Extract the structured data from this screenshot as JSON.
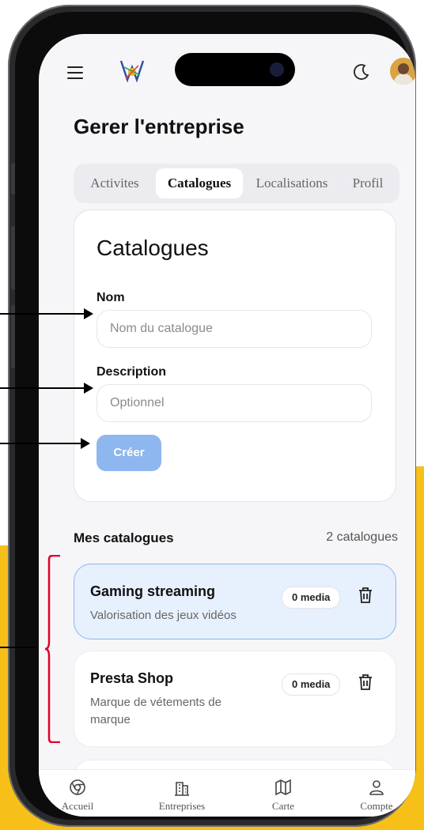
{
  "header": {
    "title": "Gerer l'entreprise"
  },
  "tabs": [
    {
      "label": "Activites",
      "active": false
    },
    {
      "label": "Catalogues",
      "active": true
    },
    {
      "label": "Localisations",
      "active": false
    },
    {
      "label": "Profil",
      "active": false
    }
  ],
  "form": {
    "title": "Catalogues",
    "name_label": "Nom",
    "name_placeholder": "Nom du catalogue",
    "description_label": "Description",
    "description_placeholder": "Optionnel",
    "create_label": "Créer"
  },
  "catalogs": {
    "title": "Mes catalogues",
    "count": "2 catalogues",
    "items": [
      {
        "name": "Gaming streaming",
        "description": "Valorisation des jeux vidéos",
        "media": "0 media",
        "selected": true
      },
      {
        "name": "Presta Shop",
        "description": "Marque de vétements de marque",
        "media": "0 media",
        "selected": false
      }
    ]
  },
  "nav": [
    {
      "label": "Accueil",
      "icon": "chrome-icon"
    },
    {
      "label": "Entreprises",
      "icon": "building-icon"
    },
    {
      "label": "Carte",
      "icon": "map-icon"
    },
    {
      "label": "Compte",
      "icon": "user-icon"
    }
  ],
  "colors": {
    "accent": "#8db7ee",
    "selected_bg": "#e7f0fd",
    "annotation_bracket": "#e3002b",
    "background_yellow": "#f6c019"
  }
}
